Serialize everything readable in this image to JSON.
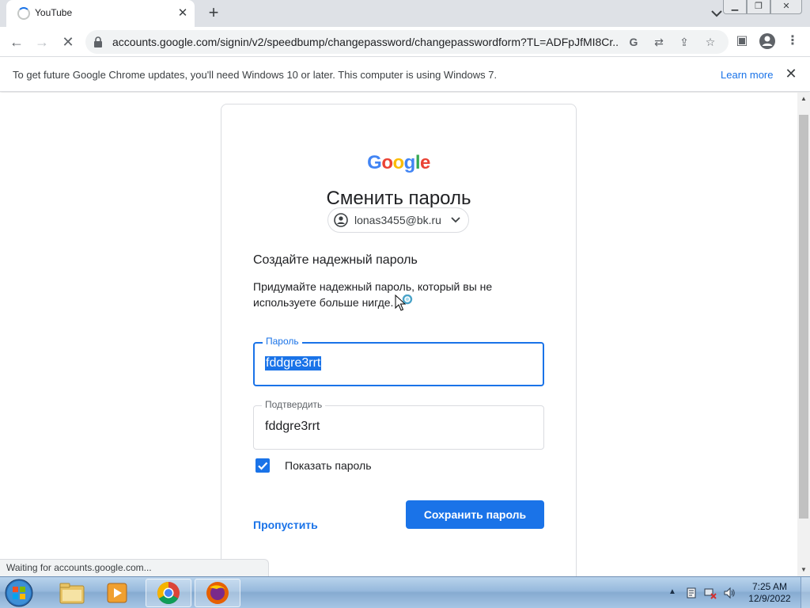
{
  "browser": {
    "tab": {
      "title": "YouTube"
    },
    "url": "accounts.google.com/signin/v2/speedbump/changepassword/changepasswordform?TL=ADFpJfMI8Cr..."
  },
  "infobar": {
    "message": "To get future Google Chrome updates, you'll need Windows 10 or later. This computer is using Windows 7.",
    "link": "Learn more"
  },
  "form": {
    "logo": "Google",
    "heading": "Сменить пароль",
    "account_email": "lonas3455@bk.ru",
    "subheading": "Создайте надежный пароль",
    "description": "Придумайте надежный пароль, который вы не используете больше нигде.",
    "password": {
      "label": "Пароль",
      "value": "fddgre3rrt"
    },
    "confirm": {
      "label": "Подтвердить",
      "value": "fddgre3rrt"
    },
    "show_password": {
      "label": "Показать пароль",
      "checked": true
    },
    "skip": "Пропустить",
    "save": "Сохранить пароль"
  },
  "status": "Waiting for accounts.google.com...",
  "taskbar": {
    "time": "7:25 AM",
    "date": "12/9/2022"
  },
  "colors": {
    "accent": "#1a73e8",
    "google_blue": "#4285F4",
    "google_red": "#EA4335",
    "google_yellow": "#FBBC05",
    "google_green": "#34A853"
  }
}
